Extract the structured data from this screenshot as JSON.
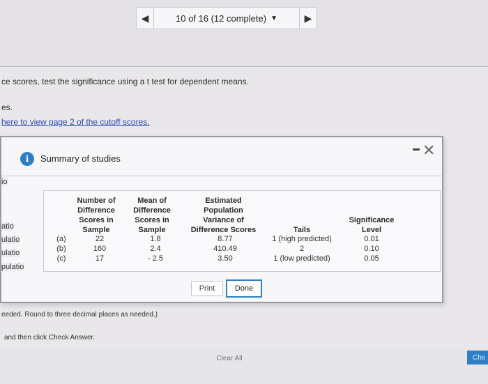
{
  "nav": {
    "counter": "10 of 16 (12 complete)",
    "prev_icon": "triangle-left",
    "next_icon": "triangle-right"
  },
  "question": {
    "line1": "ce scores, test the significance using a t test for dependent means.",
    "line2": "es.",
    "link": "here to view page 2 of the cutoff scores."
  },
  "dialog": {
    "title": "Summary of studies",
    "side_fragments": [
      "io",
      "atio",
      "ulatio",
      "ulatio",
      "pulatio"
    ],
    "headers": {
      "study": "",
      "n": [
        "Number of",
        "Difference",
        "Scores in",
        "Sample"
      ],
      "mean": [
        "Mean of",
        "Difference",
        "Scores in",
        "Sample"
      ],
      "variance": [
        "Estimated",
        "Population",
        "Variance of",
        "Difference Scores"
      ],
      "tails": [
        "Tails"
      ],
      "sig": [
        "Significance",
        "Level"
      ]
    },
    "rows": [
      {
        "study": "(a)",
        "n": "22",
        "mean": "1.8",
        "variance": "8.77",
        "tails": "1 (high predicted)",
        "sig": "0.01"
      },
      {
        "study": "(b)",
        "n": "160",
        "mean": "2.4",
        "variance": "410.49",
        "tails": "2",
        "sig": "0.10"
      },
      {
        "study": "(c)",
        "n": "17",
        "mean": "- 2.5",
        "variance": "3.50",
        "tails": "1 (low predicted)",
        "sig": "0.05"
      }
    ],
    "print_label": "Print",
    "done_label": "Done"
  },
  "footer": {
    "round_note": "eeded. Round to three decimal places as needed.)",
    "instruction": "and then click Check Answer.",
    "clear_all": "Clear All",
    "check": "Che"
  },
  "colors": {
    "accent": "#2f7fc6",
    "link": "#2a4fb3"
  }
}
